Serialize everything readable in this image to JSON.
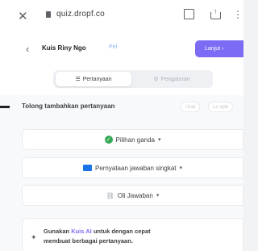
{
  "browser": {
    "url": "quiz.dropf.co",
    "close_glyph": "✕",
    "more_glyph": "⋮"
  },
  "header": {
    "back_glyph": "‹",
    "title": "Kuis Riny Ngo",
    "tag": "Pel",
    "next_label": "Lanjut ›"
  },
  "tabs": [
    {
      "label": "Pertanyaan",
      "active": true
    },
    {
      "label": "Pengaturan",
      "active": false
    }
  ],
  "section": {
    "title": "Tolong tambahkan pertanyaan",
    "pill_left": "Unai",
    "pill_right": "Lo sple"
  },
  "options": [
    {
      "label": "Pilihan ganda",
      "icon": "check-circle-icon"
    },
    {
      "label": "Pernyataan jawaban singkat",
      "icon": "document-icon"
    },
    {
      "label": "Oli Jawaban",
      "icon": "link-icon"
    }
  ],
  "suggestion": {
    "prefix": "Gunakan ",
    "ai_name": "Kuis AI",
    "rest_line1": " untuk dengan cepat",
    "line2": "membuat berbagai pertanyaan."
  },
  "colors": {
    "accent": "#7c6cf5",
    "green": "#34a853",
    "blue": "#1a73e8"
  }
}
